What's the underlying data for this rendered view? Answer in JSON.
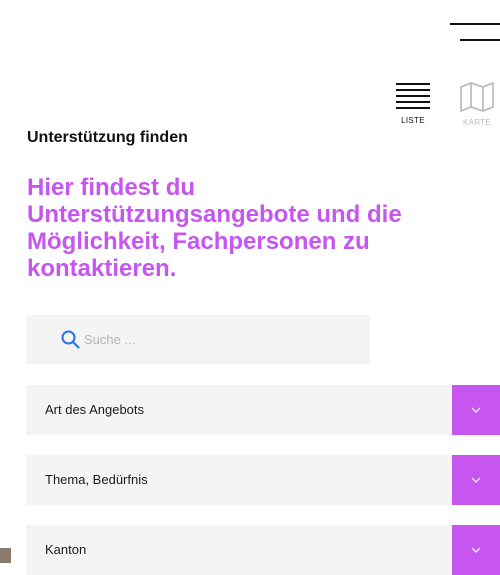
{
  "header": {
    "menu_icon": "hamburger-menu-icon"
  },
  "view_switch": {
    "list": {
      "label": "LISTE",
      "icon": "list-icon",
      "active": true
    },
    "map": {
      "label": "KARTE",
      "icon": "map-icon",
      "active": false
    }
  },
  "page": {
    "title": "Unterstützung finden",
    "intro": "Hier findest du Unterstützungsangebote und die Möglichkeit, Fachpersonen zu kontaktieren."
  },
  "search": {
    "placeholder": "Suche ...",
    "value": "",
    "icon": "search-icon"
  },
  "filters": [
    {
      "label": "Art des Angebots",
      "icon": "chevron-down-icon"
    },
    {
      "label": "Thema, Bedürfnis",
      "icon": "chevron-down-icon"
    },
    {
      "label": "Kanton",
      "icon": "chevron-down-icon"
    }
  ],
  "colors": {
    "accent": "#c656ef",
    "field_bg": "#f4f4f4",
    "text": "#111111",
    "inactive": "#bdbdbd"
  }
}
